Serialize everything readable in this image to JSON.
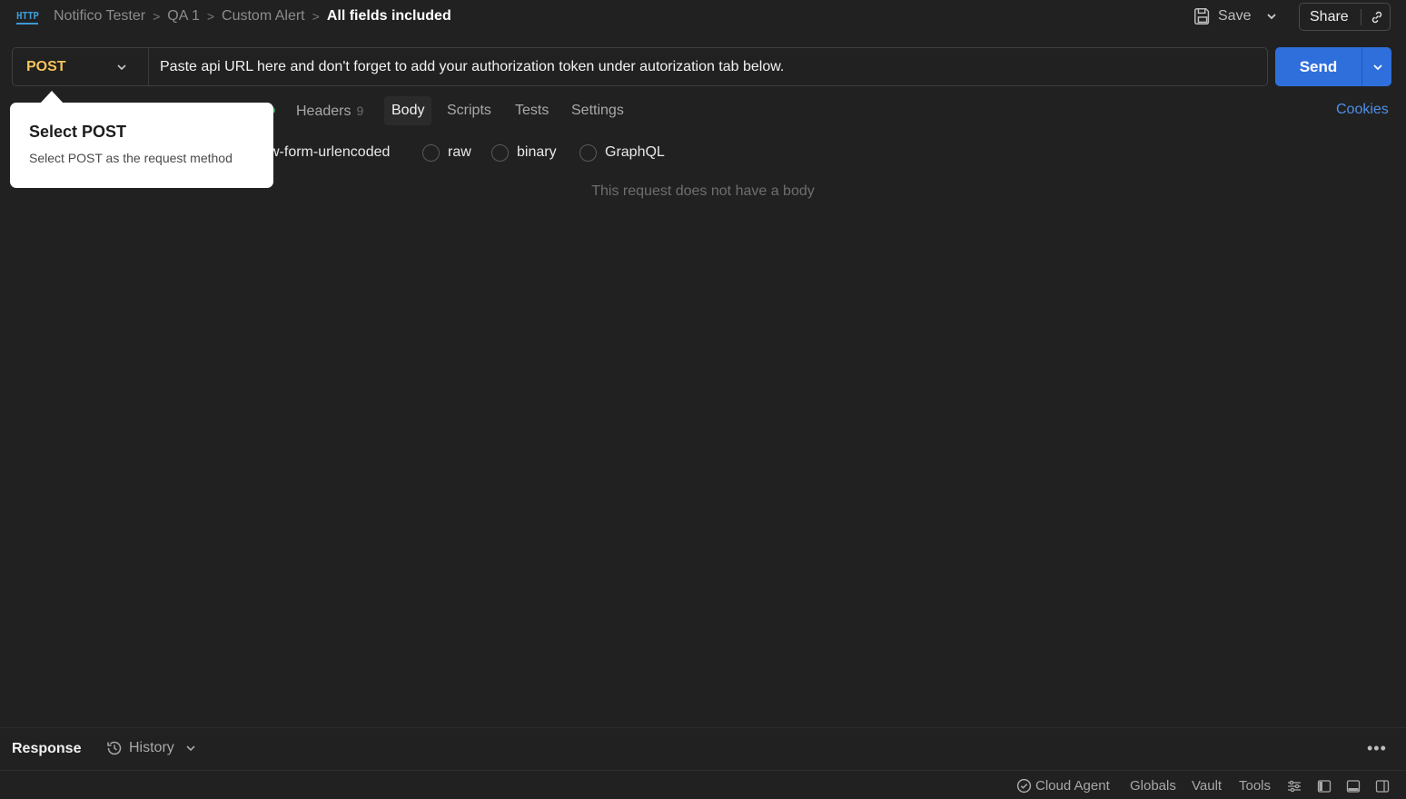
{
  "header": {
    "breadcrumb": [
      "Notifico Tester",
      "QA 1",
      "Custom Alert"
    ],
    "current": "All fields included",
    "save_label": "Save",
    "share_label": "Share",
    "icon_text": "HTTP"
  },
  "request": {
    "method": "POST",
    "url": "Paste api URL here and don't forget to add your authorization token under autorization tab below.",
    "send_label": "Send"
  },
  "tabs": [
    {
      "label": "Headers",
      "count": "9"
    },
    {
      "label": "Body"
    },
    {
      "label": "Scripts"
    },
    {
      "label": "Tests"
    },
    {
      "label": "Settings"
    }
  ],
  "active_tab": "Body",
  "cookies_label": "Cookies",
  "body_types": [
    "x-www-form-urlencoded",
    "raw",
    "binary",
    "GraphQL"
  ],
  "body_types_visible": [
    "w-form-urlencoded",
    "raw",
    "binary",
    "GraphQL"
  ],
  "empty_message": "This request does not have a body",
  "tooltip": {
    "title": "Select POST",
    "description": "Select POST as the request method"
  },
  "response_bar": {
    "response_label": "Response",
    "history_label": "History"
  },
  "status_bar": {
    "cloud_agent": "Cloud Agent",
    "globals": "Globals",
    "vault": "Vault",
    "tools": "Tools"
  },
  "colors": {
    "background": "#212121",
    "method": "#f5c35a",
    "send": "#2f6fdc",
    "link": "#4f8fe6",
    "icon": "#3d9bd6"
  }
}
